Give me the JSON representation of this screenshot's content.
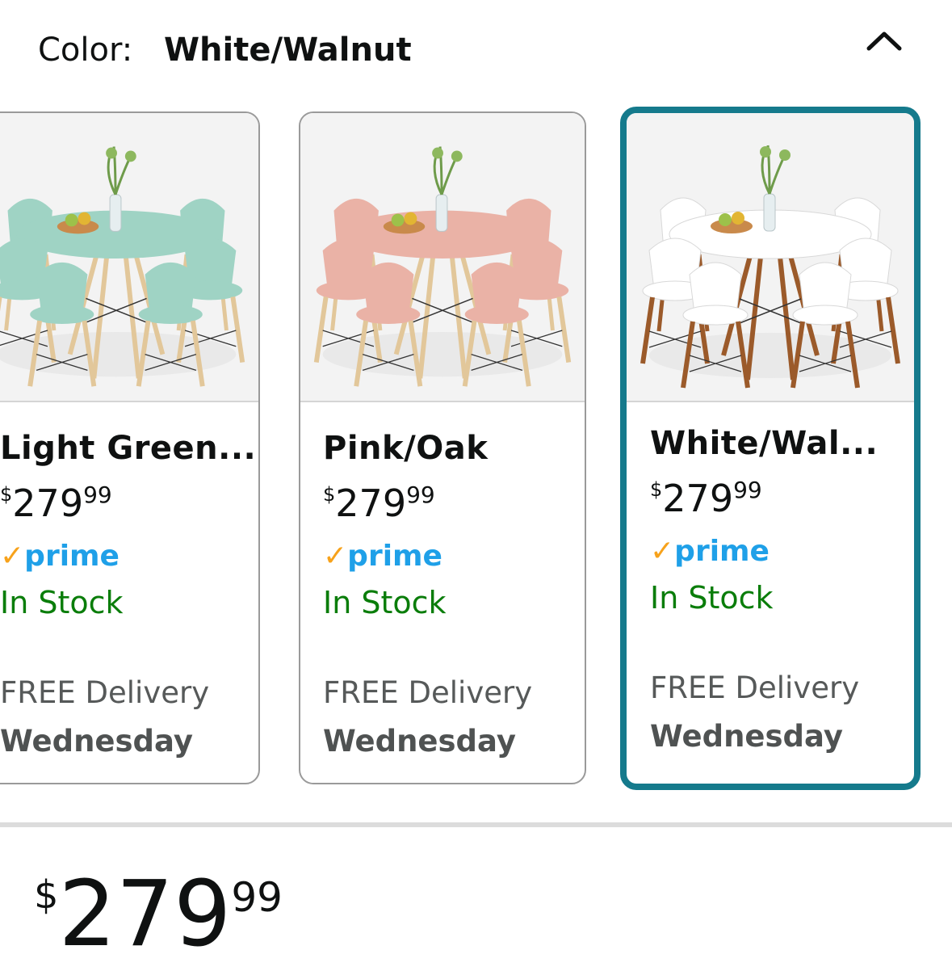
{
  "header": {
    "label": "Color:",
    "selected_value": "White/Walnut"
  },
  "icons": {
    "collapse": "chevron-up-icon",
    "prime_check": "checkmark-icon"
  },
  "colors": {
    "selected_border": "#157a8c",
    "prime_blue": "#1fa0e8",
    "prime_check": "#f7a21b",
    "in_stock": "#0a7d0a"
  },
  "options": [
    {
      "name": "Light Green...",
      "price_symbol": "$",
      "price_dollars": "279",
      "price_cents": "99",
      "prime": "prime",
      "stock": "In Stock",
      "delivery": "FREE Delivery",
      "day": "Wednesday",
      "selected": false,
      "seat_color": "#9fd3c4",
      "leg_color": "#e2c79a"
    },
    {
      "name": "Pink/Oak",
      "price_symbol": "$",
      "price_dollars": "279",
      "price_cents": "99",
      "prime": "prime",
      "stock": "In Stock",
      "delivery": "FREE Delivery",
      "day": "Wednesday",
      "selected": false,
      "seat_color": "#eab2a6",
      "leg_color": "#e2c79a"
    },
    {
      "name": "White/Wal...",
      "price_symbol": "$",
      "price_dollars": "279",
      "price_cents": "99",
      "prime": "prime",
      "stock": "In Stock",
      "delivery": "FREE Delivery",
      "day": "Wednesday",
      "selected": true,
      "seat_color": "#ffffff",
      "leg_color": "#9b5a2a"
    }
  ],
  "main_price": {
    "symbol": "$",
    "dollars": "279",
    "cents": "99"
  }
}
